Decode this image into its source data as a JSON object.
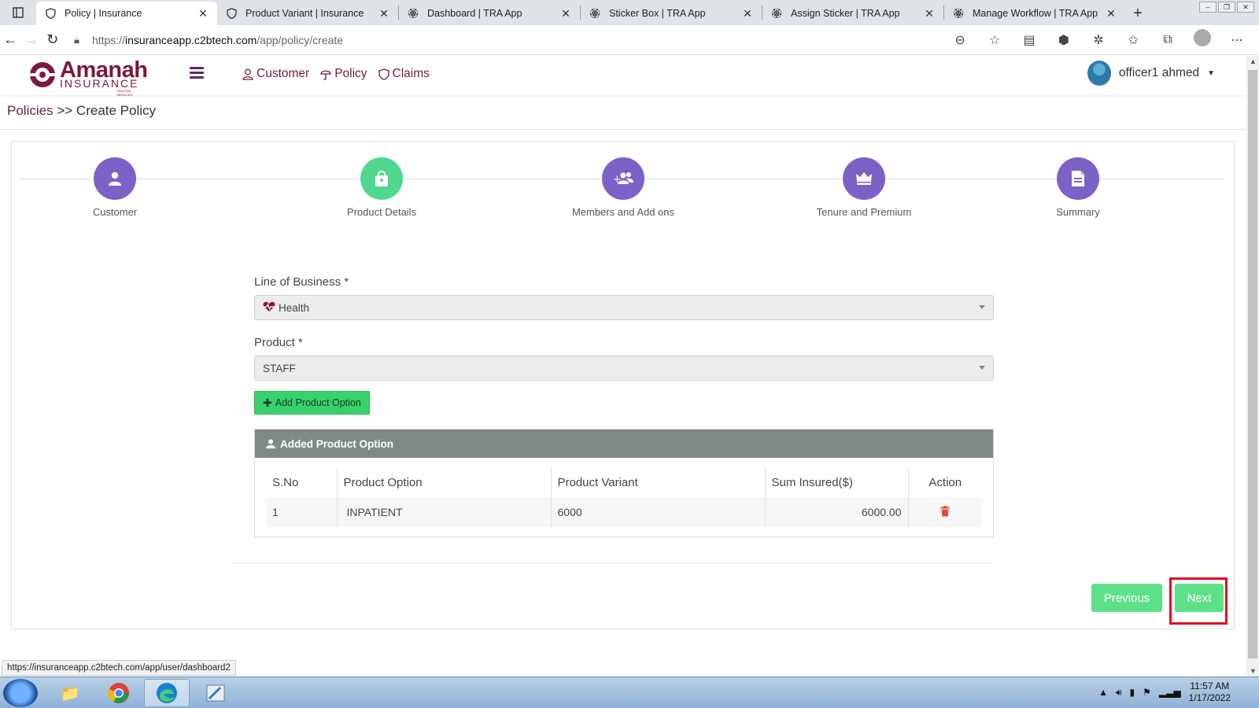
{
  "browser": {
    "tabs": [
      {
        "title": "Policy | Insurance",
        "active": true,
        "icon": "shield-icon"
      },
      {
        "title": "Product Variant | Insurance",
        "active": false,
        "icon": "shield-icon"
      },
      {
        "title": "Dashboard | TRA App",
        "active": false,
        "icon": "emblem-icon"
      },
      {
        "title": "Sticker Box | TRA App",
        "active": false,
        "icon": "emblem-icon"
      },
      {
        "title": "Assign Sticker | TRA App",
        "active": false,
        "icon": "emblem-icon"
      },
      {
        "title": "Manage Workflow | TRA App",
        "active": false,
        "icon": "emblem-icon"
      }
    ],
    "url_prefix": "https://",
    "url_host": "insuranceapp.c2btech.com",
    "url_path": "/app/policy/create",
    "status_url": "https://insuranceapp.c2btech.com/app/user/dashboard2"
  },
  "app": {
    "logo_name": "Amanah",
    "logo_sub": "INSURANCE",
    "logo_tag": "TRUSTED SERVICES",
    "nav": [
      {
        "label": "Customer",
        "icon": "person-icon"
      },
      {
        "label": "Policy",
        "icon": "umbrella-icon"
      },
      {
        "label": "Claims",
        "icon": "shield-icon"
      }
    ],
    "user_name": "officer1 ahmed"
  },
  "breadcrumb": {
    "root": "Policies",
    "sep": ">>",
    "current": "Create Policy"
  },
  "steps": [
    {
      "label": "Customer",
      "icon": "user-icon",
      "color": "#7c62c6"
    },
    {
      "label": "Product Details",
      "icon": "bag-icon",
      "color": "#4fd78e"
    },
    {
      "label": "Members and Add ons",
      "icon": "users-add-icon",
      "color": "#7c62c6"
    },
    {
      "label": "Tenure and Premium",
      "icon": "crown-icon",
      "color": "#7c62c6"
    },
    {
      "label": "Summary",
      "icon": "document-icon",
      "color": "#7c62c6"
    }
  ],
  "form": {
    "lob_label": "Line of Business *",
    "lob_value": "Health",
    "product_label": "Product *",
    "product_value": "STAFF",
    "add_option_label": "Add Product Option"
  },
  "panel": {
    "title": "Added Product Option",
    "columns": [
      "S.No",
      "Product Option",
      "Product Variant",
      "Sum Insured($)",
      "Action"
    ],
    "rows": [
      {
        "sno": "1",
        "option": "INPATIENT",
        "variant": "6000",
        "sum": "6000.00"
      }
    ]
  },
  "buttons": {
    "previous": "Previous",
    "next": "Next"
  },
  "taskbar": {
    "time": "11:57 AM",
    "date": "1/17/2022"
  },
  "colors": {
    "brand": "#7b1a3a",
    "step_purple": "#7c62c6",
    "step_green": "#4fd78e",
    "button_green": "#5ee089",
    "highlight": "#e0101a"
  }
}
